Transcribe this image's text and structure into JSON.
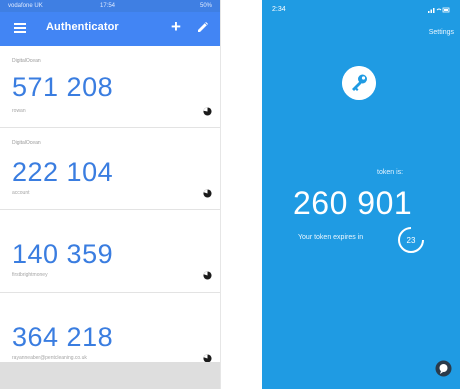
{
  "left_app": {
    "status_bar": {
      "carrier": "vodafone UK",
      "time": "17:54",
      "battery": "50%"
    },
    "appbar": {
      "title": "Authenticator"
    },
    "tokens": [
      {
        "issuer": "DigitalOcean",
        "code": "571 208",
        "account": "rowan"
      },
      {
        "issuer": "DigitalOcean",
        "code": "222 104",
        "account": "account"
      },
      {
        "issuer": "",
        "code": "140 359",
        "account": "firstbrightmoney"
      },
      {
        "issuer": "",
        "code": "364 218",
        "account": "rayanneaber@pentcleaning.co.uk"
      }
    ]
  },
  "right_app": {
    "status_bar": {
      "time": "2:34"
    },
    "settings_label": "Settings",
    "token_label": "token is:",
    "token_value": "260 901",
    "expiry_label": "Your token expires in",
    "timer_seconds": "23"
  },
  "colors": {
    "left_header": "#4285f4",
    "left_code": "#3a7de0",
    "right_background": "#1f9be3"
  }
}
